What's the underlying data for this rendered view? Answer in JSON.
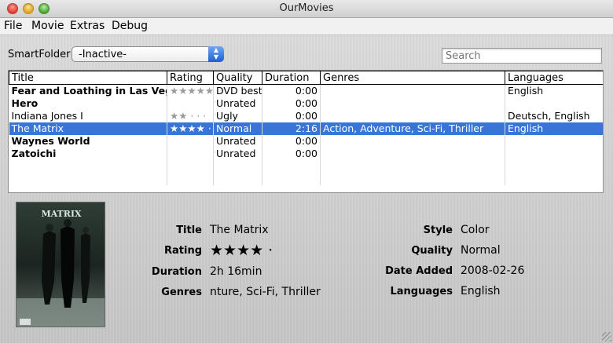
{
  "window": {
    "title": "OurMovies"
  },
  "menus": [
    "File",
    "Movie",
    "Extras",
    "Debug"
  ],
  "smartfolder": {
    "label": "SmartFolder",
    "value": "-Inactive-"
  },
  "search": {
    "placeholder": "Search"
  },
  "table": {
    "columns": [
      "Title",
      "Rating",
      "Quality",
      "Duration",
      "Genres",
      "Languages"
    ],
    "rows": [
      {
        "title": "Fear and Loathing in Las Vegas",
        "rating": 0,
        "rating_glyph": "★★★★★",
        "quality": "DVD best",
        "duration": "0:00",
        "genres": "",
        "languages": "English",
        "bold": true,
        "selected": false
      },
      {
        "title": "Hero",
        "rating": 0,
        "rating_glyph": "",
        "quality": "Unrated",
        "duration": "0:00",
        "genres": "",
        "languages": "",
        "bold": true,
        "selected": false
      },
      {
        "title": "Indiana Jones I",
        "rating": 2,
        "rating_glyph": "★★ · · ·",
        "quality": "Ugly",
        "duration": "0:00",
        "genres": "",
        "languages": "Deutsch, English",
        "bold": false,
        "selected": false
      },
      {
        "title": "The Matrix",
        "rating": 4,
        "rating_glyph": "★★★★ ·",
        "quality": "Normal",
        "duration": "2:16",
        "genres": "Action, Adventure, Sci-Fi, Thriller",
        "languages": "English",
        "bold": false,
        "selected": true
      },
      {
        "title": "Waynes World",
        "rating": 0,
        "rating_glyph": "",
        "quality": "Unrated",
        "duration": "0:00",
        "genres": "",
        "languages": "",
        "bold": true,
        "selected": false
      },
      {
        "title": "Zatoichi",
        "rating": 0,
        "rating_glyph": "",
        "quality": "Unrated",
        "duration": "0:00",
        "genres": "",
        "languages": "",
        "bold": true,
        "selected": false
      }
    ]
  },
  "detail": {
    "poster_title": "MATRIX",
    "labels": {
      "title": "Title",
      "rating": "Rating",
      "duration": "Duration",
      "genres": "Genres",
      "style": "Style",
      "quality": "Quality",
      "date_added": "Date Added",
      "languages": "Languages"
    },
    "values": {
      "title": "The Matrix",
      "rating": 4,
      "rating_glyph": "★★★★ ·",
      "duration": "2h 16min",
      "genres": "nture, Sci-Fi, Thriller",
      "style": "Color",
      "quality": "Normal",
      "date_added": "2008-02-26",
      "languages": "English"
    }
  },
  "colors": {
    "selection": "#3875d7",
    "close": "#d8322a",
    "minimize": "#d89a1a",
    "maximize": "#3c9a2a"
  }
}
